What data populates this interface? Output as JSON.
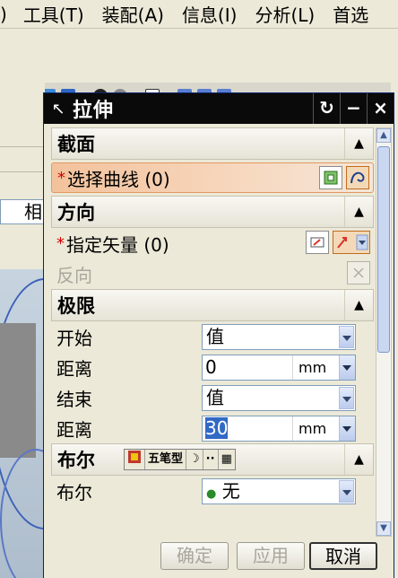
{
  "menubar": {
    "items": [
      ")",
      "工具(T)",
      "装配(A)",
      "信息(I)",
      "分析(L)",
      "首选"
    ]
  },
  "left_panel": {
    "combo_text": "相"
  },
  "dialog": {
    "title": "拉伸",
    "buttons": {
      "restore": "↻",
      "minimize": "−",
      "close": "×"
    },
    "sections": {
      "section": {
        "title": "截面",
        "select_curve_label": "选择曲线 (0)"
      },
      "direction": {
        "title": "方向",
        "specify_vector_label": "指定矢量 (0)",
        "reverse_label": "反向"
      },
      "limits": {
        "title": "极限",
        "start_label": "开始",
        "start_value": "值",
        "start_distance_label": "距离",
        "start_distance_value": "0",
        "start_distance_unit": "mm",
        "end_label": "结束",
        "end_value": "值",
        "end_distance_label": "距离",
        "end_distance_value": "30",
        "end_distance_unit": "mm"
      },
      "boolean": {
        "title": "布尔",
        "ime": [
          "五笔型"
        ],
        "boolean_label": "布尔",
        "boolean_value": "无"
      }
    },
    "footer": {
      "ok": "确定",
      "apply": "应用",
      "cancel": "取消"
    }
  },
  "colors": {
    "titlebar": "#0a0a0a",
    "selected_row": "#f3c29c",
    "required_star": "#d40000",
    "viewport_curve": "#3a5fb8"
  }
}
